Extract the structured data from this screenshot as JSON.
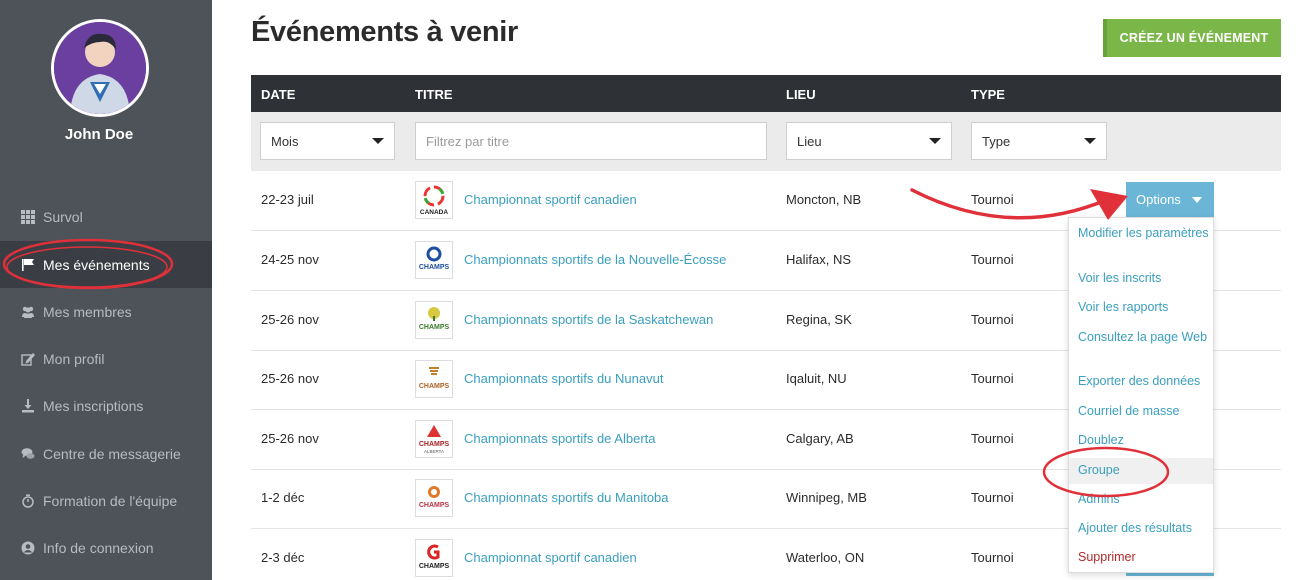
{
  "user": {
    "name": "John Doe"
  },
  "nav": [
    {
      "label": "Survol",
      "icon": "grid-icon"
    },
    {
      "label": "Mes événements",
      "icon": "flag-icon"
    },
    {
      "label": "Mes membres",
      "icon": "users-icon"
    },
    {
      "label": "Mon profil",
      "icon": "edit-icon"
    },
    {
      "label": "Mes inscriptions",
      "icon": "download-icon"
    },
    {
      "label": "Centre de messagerie",
      "icon": "comments-icon"
    },
    {
      "label": "Formation de l'équipe",
      "icon": "stopwatch-icon"
    },
    {
      "label": "Info de connexion",
      "icon": "user-circle-icon"
    }
  ],
  "page": {
    "title": "Événements à venir",
    "create_label": "CRÉEZ UN ÉVÉNEMENT"
  },
  "table": {
    "headers": {
      "date": "DATE",
      "title": "TITRE",
      "location": "LIEU",
      "type": "TYPE"
    },
    "filters": {
      "month": "Mois",
      "title_placeholder": "Filtrez par titre",
      "location": "Lieu",
      "type": "Type"
    },
    "rows": [
      {
        "date": "22-23 juil",
        "title": "Championnat sportif canadien",
        "location": "Moncton, NB",
        "type": "Tournoi",
        "logo": "canada-logo"
      },
      {
        "date": "24-25 nov",
        "title": "Championnats sportifs de la Nouvelle-Écosse",
        "location": "Halifax, NS",
        "type": "Tournoi",
        "logo": "champs-logo"
      },
      {
        "date": "25-26 nov",
        "title": "Championnats sportifs de la Saskatchewan",
        "location": "Regina, SK",
        "type": "Tournoi",
        "logo": "champs-logo"
      },
      {
        "date": "25-26 nov",
        "title": "Championnats sportifs du Nunavut",
        "location": "Iqaluit, NU",
        "type": "Tournoi",
        "logo": "champs-logo"
      },
      {
        "date": "25-26 nov",
        "title": "Championnats sportifs de Alberta",
        "location": "Calgary, AB",
        "type": "Tournoi",
        "logo": "champs-logo"
      },
      {
        "date": "1-2 déc",
        "title": "Championnats sportifs du Manitoba",
        "location": "Winnipeg, MB",
        "type": "Tournoi",
        "logo": "champs-logo"
      },
      {
        "date": "2-3 déc",
        "title": "Championnat sportif canadien",
        "location": "Waterloo, ON",
        "type": "Tournoi",
        "logo": "champs-logo"
      }
    ]
  },
  "options": {
    "label": "Options",
    "menu": [
      "Modifier les paramètres",
      "Voir les inscrits",
      "Voir les rapports",
      "Consultez la page Web",
      "Exporter des données",
      "Courriel de masse",
      "Doublez",
      "Groupe",
      "Admins",
      "Ajouter des résultats",
      "Supprimer"
    ]
  },
  "colors": {
    "accent": "#7ab648",
    "link": "#3a9fbf",
    "options": "#6bb6d6",
    "annotation": "#e0313a",
    "danger": "#b02a2a"
  }
}
